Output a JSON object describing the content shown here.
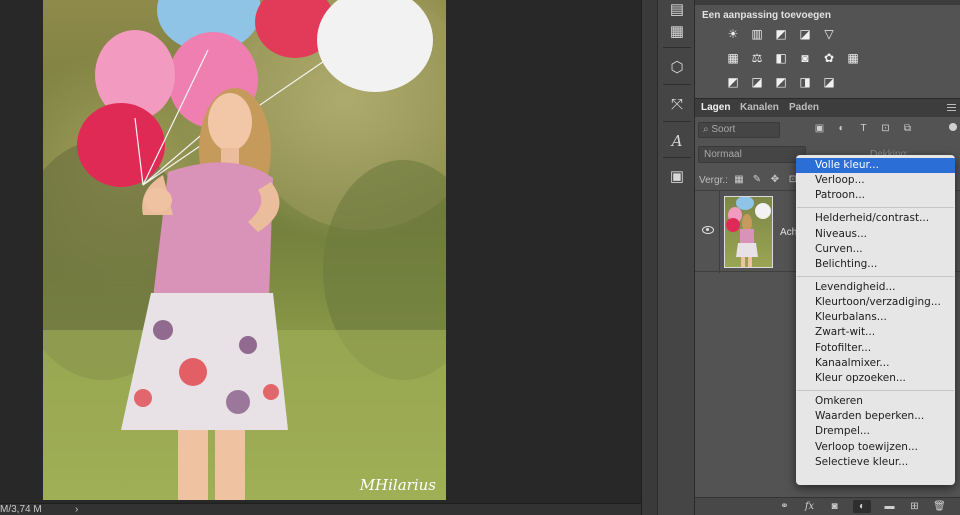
{
  "canvas": {
    "watermark": "MHilarius",
    "status_doc": "M/3,74 M",
    "status_arrow": "›"
  },
  "sidebar_icons": [
    "history-icon",
    "notes-icon",
    "3d-icon",
    "paths-icon",
    "character-icon",
    "properties-icon"
  ],
  "adjustments": {
    "title": "Een aanpassing toevoegen",
    "row1": [
      "☀",
      "▥",
      "◩",
      "◪",
      "▽"
    ],
    "row2": [
      "▦",
      "⚖",
      "◧",
      "◙",
      "✿",
      "▦"
    ],
    "row3": [
      "◩",
      "◪",
      "◩",
      "◨",
      "◪"
    ]
  },
  "layers_panel": {
    "tabs": [
      "Lagen",
      "Kanalen",
      "Paden"
    ],
    "filter_label": "Soort",
    "blend_mode": "Normaal",
    "opacity_label": "Dekking:",
    "lock_label": "Vergr.:",
    "layer_name": "Ach"
  },
  "menu": {
    "groups": [
      [
        "Volle kleur...",
        "Verloop...",
        "Patroon..."
      ],
      [
        "Helderheid/contrast...",
        "Niveaus...",
        "Curven...",
        "Belichting..."
      ],
      [
        "Levendigheid...",
        "Kleurtoon/verzadiging...",
        "Kleurbalans...",
        "Zwart-wit...",
        "Fotofilter...",
        "Kanaalmixer...",
        "Kleur opzoeken..."
      ],
      [
        "Omkeren",
        "Waarden beperken...",
        "Drempel...",
        "Verloop toewijzen...",
        "Selectieve kleur..."
      ]
    ],
    "selected": "Volle kleur..."
  },
  "colors": {
    "menu_highlight": "#2b6fd6",
    "panel_bg": "#535353"
  }
}
